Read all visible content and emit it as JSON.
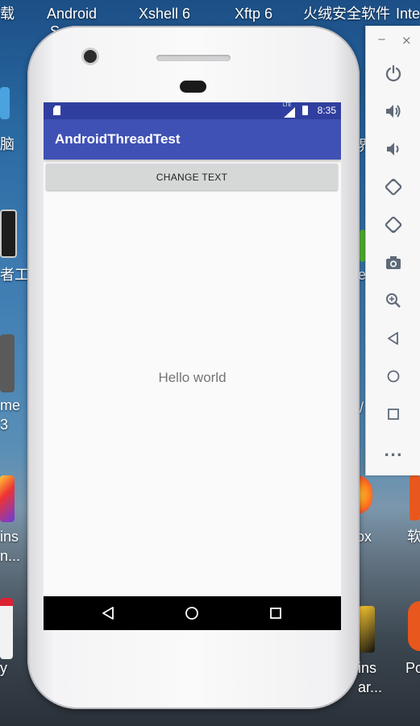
{
  "desktop": {
    "top_labels": [
      "载",
      "Android",
      "Xshell 6",
      "Xftp 6",
      "火绒安全软件",
      "Inte"
    ],
    "left_labels": [
      "脑",
      "者工",
      "me",
      "3",
      "ins",
      "n...",
      "y"
    ],
    "right_labels": [
      "界",
      "e",
      "/",
      "ox",
      "软",
      "ins",
      "ar...",
      "Po"
    ],
    "android_sub": "S"
  },
  "phone": {
    "status_bar": {
      "time": "8:35",
      "network": "LTE"
    },
    "app_title": "AndroidThreadTest",
    "button_label": "CHANGE TEXT",
    "text_view": "Hello world",
    "colors": {
      "primary": "#3f51b5",
      "primary_dark": "#303f9f",
      "background": "#fafafa"
    }
  },
  "emulator_toolbar": {
    "minimize": "−",
    "close": "×",
    "controls": [
      "power-icon",
      "volume-up-icon",
      "volume-down-icon",
      "rotate-left-icon",
      "rotate-right-icon",
      "camera-icon",
      "zoom-icon",
      "back-icon",
      "home-icon",
      "overview-icon",
      "more-icon"
    ],
    "more": "..."
  }
}
